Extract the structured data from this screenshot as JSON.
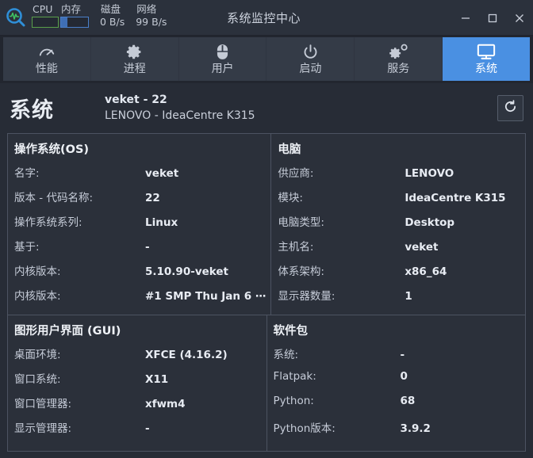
{
  "titlebar": {
    "app_icon": "magnifier-waveform-icon",
    "window_title": "系统监控中心",
    "meters": [
      {
        "label": "CPU",
        "type": "bar",
        "fill_percent": 0,
        "color": "#5a9e4a",
        "value": ""
      },
      {
        "label": "内存",
        "type": "bar",
        "fill_percent": 24,
        "color": "#3f6fb5",
        "value": ""
      },
      {
        "label": "磁盘",
        "type": "text",
        "value": "0 B/s"
      },
      {
        "label": "网络",
        "type": "text",
        "value": "99 B/s"
      }
    ],
    "controls": {
      "minimize": "—",
      "maximize": "□",
      "close": "✕"
    }
  },
  "tabs": [
    {
      "label": "性能",
      "icon": "gauge-icon",
      "active": false
    },
    {
      "label": "进程",
      "icon": "gear-icon",
      "active": false
    },
    {
      "label": "用户",
      "icon": "mouse-icon",
      "active": false
    },
    {
      "label": "启动",
      "icon": "power-icon",
      "active": false
    },
    {
      "label": "服务",
      "icon": "gears-icon",
      "active": false
    },
    {
      "label": "系统",
      "icon": "monitor-icon",
      "active": true
    }
  ],
  "header": {
    "title": "系统",
    "line1": "veket - 22",
    "line2": "LENOVO - IdeaCentre K315",
    "refresh_icon": "refresh-icon"
  },
  "sections": {
    "os": {
      "title": "操作系统(OS)",
      "rows": [
        {
          "key": "名字:",
          "value": "veket"
        },
        {
          "key": "版本 - 代码名称:",
          "value": "22"
        },
        {
          "key": "操作系统系列:",
          "value": "Linux"
        },
        {
          "key": "基于:",
          "value": "-"
        },
        {
          "key": "内核版本:",
          "value": "5.10.90-veket"
        },
        {
          "key": "内核版本:",
          "value": "#1 SMP Thu Jan 6 ⋯"
        }
      ]
    },
    "computer": {
      "title": "电脑",
      "rows": [
        {
          "key": "供应商:",
          "value": "LENOVO"
        },
        {
          "key": "模块:",
          "value": "IdeaCentre K315"
        },
        {
          "key": "电脑类型:",
          "value": "Desktop"
        },
        {
          "key": "主机名:",
          "value": "veket"
        },
        {
          "key": "体系架构:",
          "value": "x86_64"
        },
        {
          "key": "显示器数量:",
          "value": "1"
        }
      ]
    },
    "gui": {
      "title": "图形用户界面 (GUI)",
      "rows": [
        {
          "key": "桌面环境:",
          "value": "XFCE (4.16.2)"
        },
        {
          "key": "窗口系统:",
          "value": "X11"
        },
        {
          "key": "窗口管理器:",
          "value": "xfwm4"
        },
        {
          "key": "显示管理器:",
          "value": "-"
        }
      ]
    },
    "packages": {
      "title": "软件包",
      "rows": [
        {
          "key": "系统:",
          "value": "-"
        },
        {
          "key": "Flatpak:",
          "value": "0"
        },
        {
          "key": "Python:",
          "value": "68"
        },
        {
          "key": "Python版本:",
          "value": "3.9.2"
        }
      ]
    }
  },
  "colors": {
    "accent": "#4a90e2",
    "window_bg": "#272c36",
    "titlebar_bg": "#2b313c",
    "panel_bg": "#2b303a",
    "tab_bg": "#343b47",
    "text": "#e8ecf3",
    "muted_text": "#c6ccd8",
    "cpu_bar": "#5a9e4a",
    "mem_bar": "#3f6fb5"
  }
}
